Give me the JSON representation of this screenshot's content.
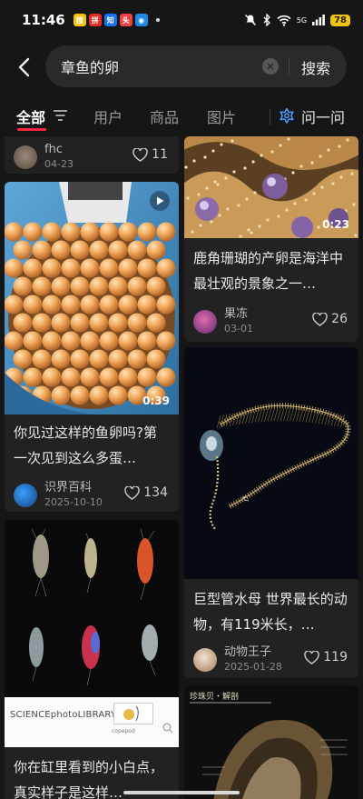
{
  "status": {
    "time": "11:46",
    "battery": "78",
    "signal": "5G",
    "apps": [
      {
        "label": "搜",
        "color": "#f4c20d"
      },
      {
        "label": "拼",
        "color": "#e02e24"
      },
      {
        "label": "知",
        "color": "#1772f6"
      },
      {
        "label": "头",
        "color": "#f04142"
      },
      {
        "label": "◉",
        "color": "#1e88e5"
      }
    ]
  },
  "search": {
    "query": "章鱼的卵",
    "button": "搜索"
  },
  "tabs": [
    {
      "label": "全部"
    },
    {
      "label": "用户"
    },
    {
      "label": "商品"
    },
    {
      "label": "图片"
    },
    {
      "label": "问一问"
    }
  ],
  "colors": {
    "accent": "#ff2442",
    "background": "#161616",
    "card": "#222222"
  },
  "posts": [
    {
      "author": "fhc",
      "date": "04-23",
      "likes": "11"
    },
    {
      "title": "你见过这样的鱼卵吗?第一次见到这么多蛋…",
      "author": "识界百科",
      "date": "2025-10-10",
      "likes": "134",
      "duration": "0:39",
      "video": true
    },
    {
      "title": "你在缸里看到的小白点，真实样子是这样…",
      "image_text": "SCIENCEphotoLIBRARY",
      "image_tag": "copepod"
    },
    {
      "title": "鹿角珊瑚的产卵是海洋中最壮观的景象之一…",
      "author": "果冻",
      "date": "03-01",
      "likes": "26",
      "duration": "0:23"
    },
    {
      "title": "巨型管水母 世界最长的动物，有119米长，…",
      "author": "动物王子",
      "date": "2025-01-28",
      "likes": "119"
    },
    {
      "image_title": "珍珠贝・解剖"
    }
  ]
}
